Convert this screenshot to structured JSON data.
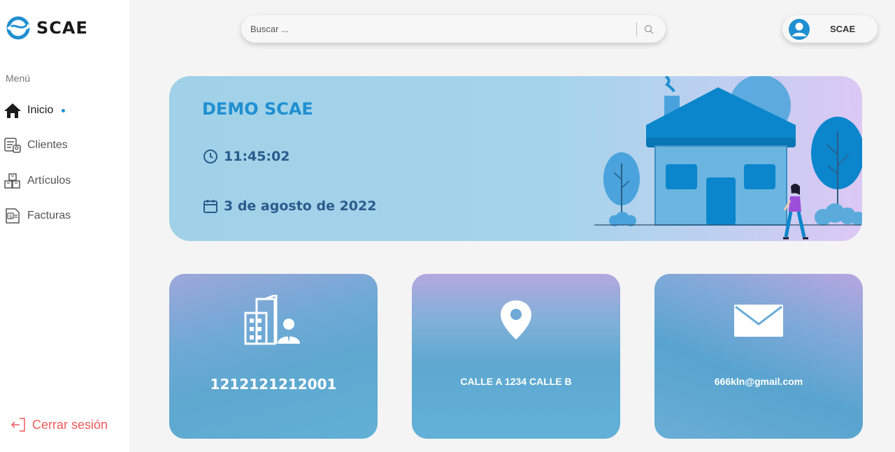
{
  "app": {
    "name": "SCAE"
  },
  "sidebar": {
    "menu_label": "Menú",
    "items": [
      {
        "label": "Inicio",
        "icon": "home-icon",
        "active": true
      },
      {
        "label": "Clientes",
        "icon": "clients-icon",
        "active": false
      },
      {
        "label": "Artículos",
        "icon": "boxes-icon",
        "active": false
      },
      {
        "label": "Facturas",
        "icon": "invoice-icon",
        "active": false
      }
    ],
    "logout_label": "Cerrar sesión"
  },
  "search": {
    "placeholder": "Buscar ...",
    "value": ""
  },
  "user": {
    "name": "SCAE"
  },
  "banner": {
    "title": "DEMO SCAE",
    "time": "11:45:02",
    "date": "3 de agosto de 2022"
  },
  "cards": [
    {
      "icon": "building-person-icon",
      "text": "1212121212001"
    },
    {
      "icon": "location-pin-icon",
      "text": "CALLE A 1234 CALLE B"
    },
    {
      "icon": "envelope-icon",
      "text": "666kln@gmail.com"
    }
  ],
  "colors": {
    "accent": "#1f8fd1",
    "logout": "#f05a5a",
    "banner_text": "#2a5b8c"
  }
}
